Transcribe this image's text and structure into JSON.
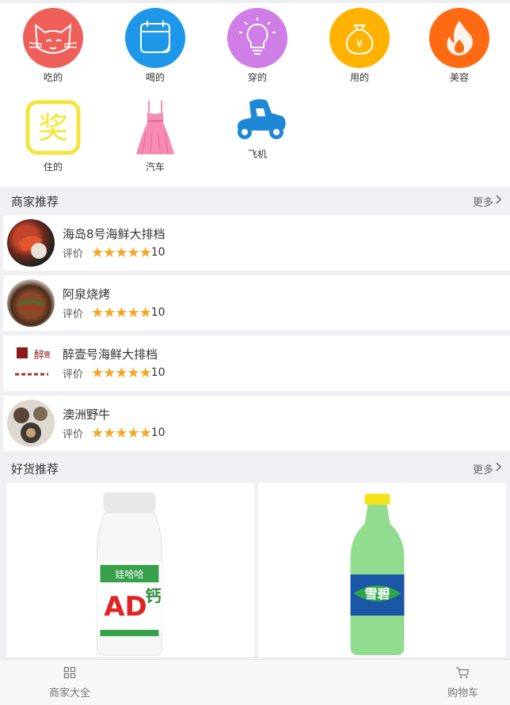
{
  "categories": [
    {
      "label": "吃的",
      "icon": "cat-face-icon",
      "color": "#ef5f5a"
    },
    {
      "label": "喝的",
      "icon": "calendar-icon",
      "color": "#1e97e8"
    },
    {
      "label": "穿的",
      "icon": "lightbulb-icon",
      "color": "#cf7ee6"
    },
    {
      "label": "用的",
      "icon": "money-bag-icon",
      "color": "#ffb300"
    },
    {
      "label": "美容",
      "icon": "flame-icon",
      "color": "#ff6a13"
    },
    {
      "label": "住的",
      "icon": "award-badge-icon",
      "color": "#f5e43a"
    },
    {
      "label": "汽车",
      "icon": "dress-icon",
      "color": "#f78bb3"
    },
    {
      "label": "飞机",
      "icon": "scooter-icon",
      "color": "#1e88d6"
    }
  ],
  "merchant_section": {
    "title": "商家推荐",
    "more": "更多"
  },
  "merchants": [
    {
      "name": "海岛8号海鲜大排档",
      "rating_label": "评价",
      "stars": "★★★★★",
      "score": "10"
    },
    {
      "name": "阿泉烧烤",
      "rating_label": "评价",
      "stars": "★★★★★",
      "score": "10"
    },
    {
      "name": "醉壹号海鲜大排档",
      "rating_label": "评价",
      "stars": "★★★★★",
      "score": "10"
    },
    {
      "name": "澳洲野牛",
      "rating_label": "评价",
      "stars": "★★★★★",
      "score": "10"
    }
  ],
  "goods_section": {
    "title": "好货推荐",
    "more": "更多"
  },
  "goods": [
    {
      "product": "AD钙奶",
      "brand": "娃哈哈"
    },
    {
      "product": "雪碧"
    }
  ],
  "tabbar": {
    "left": "商家大全",
    "right": "购物车"
  },
  "colors": {
    "star": "#f5a623",
    "page_bg": "#f0f0f4"
  }
}
